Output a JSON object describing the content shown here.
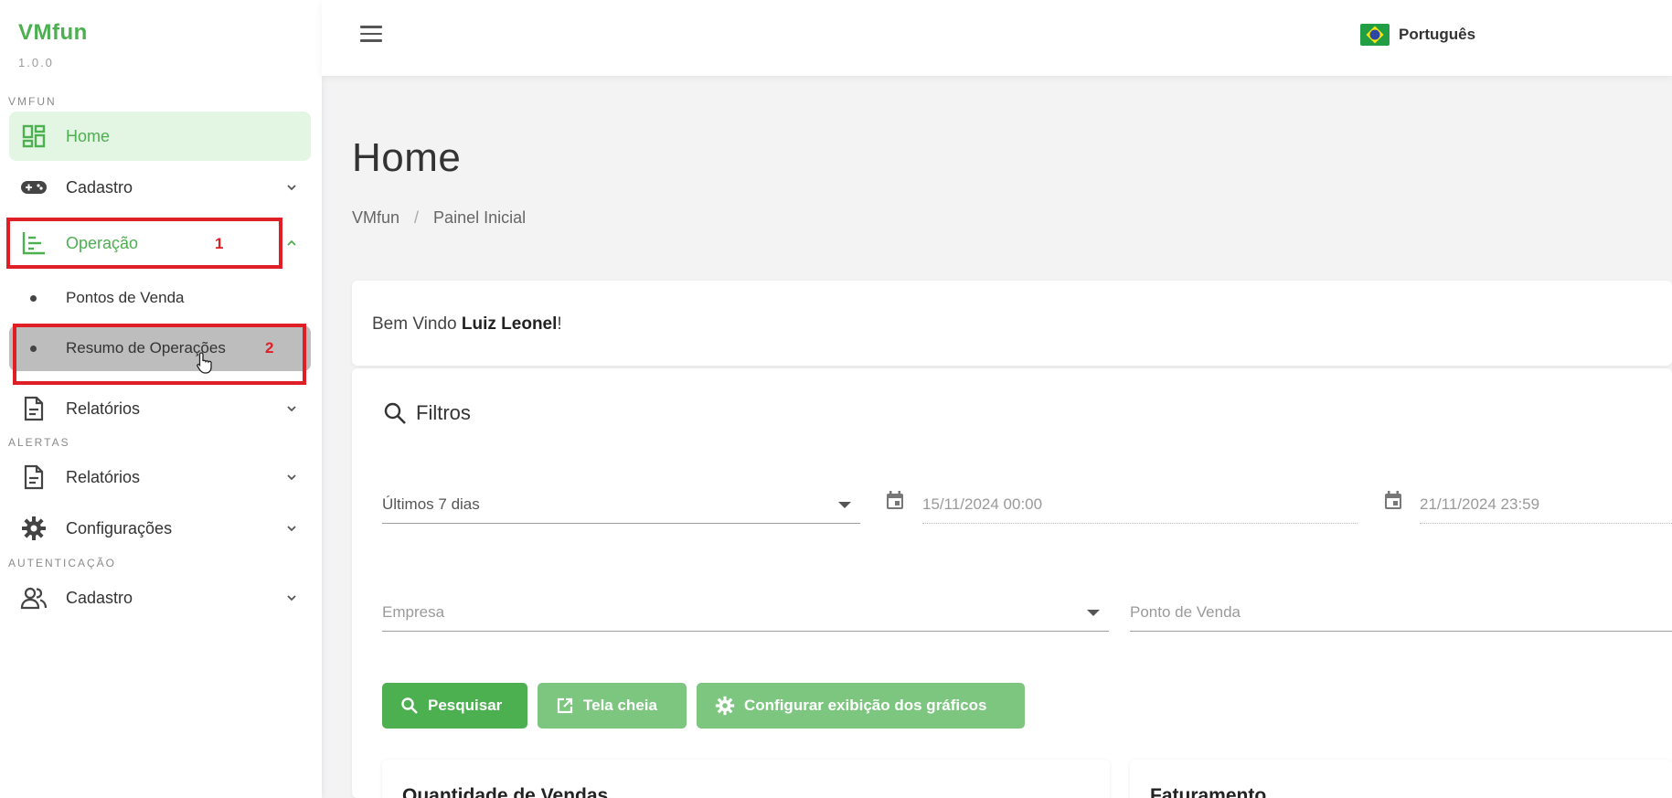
{
  "sidebar": {
    "brand": "VMfun",
    "version": "1.0.0",
    "sections": {
      "vmfun": "VMFUN",
      "alertas": "ALERTAS",
      "autenticacao": "AUTENTICAÇÃO"
    },
    "items": {
      "home": "Home",
      "cadastro": "Cadastro",
      "operacao": "Operação",
      "pontos_venda": "Pontos de Venda",
      "resumo_operacoes": "Resumo de Operações",
      "relatorios": "Relatórios",
      "relatorios_alertas": "Relatórios",
      "configuracoes": "Configurações",
      "cadastro_auth": "Cadastro"
    },
    "annotations": {
      "one": "1",
      "two": "2"
    }
  },
  "topbar": {
    "language": "Português"
  },
  "main": {
    "title": "Home",
    "breadcrumb": {
      "root": "VMfun",
      "separator": "/",
      "current": "Painel Inicial"
    },
    "welcome": {
      "prefix": "Bem Vindo ",
      "user": "Luiz Leonel",
      "suffix": "!"
    },
    "filters": {
      "title": "Filtros",
      "period": "Últimos 7 dias",
      "date_start": "15/11/2024 00:00",
      "date_end": "21/11/2024 23:59",
      "empresa_placeholder": "Empresa",
      "ponto_venda_placeholder": "Ponto de Venda"
    },
    "buttons": {
      "search": "Pesquisar",
      "fullscreen": "Tela cheia",
      "configure": "Configurar exibição dos gráficos"
    },
    "cards": {
      "vendas": "Quantidade de Vendas",
      "faturamento": "Faturamento"
    }
  },
  "colors": {
    "accent": "#4caf50",
    "annotation": "#e01e25"
  }
}
